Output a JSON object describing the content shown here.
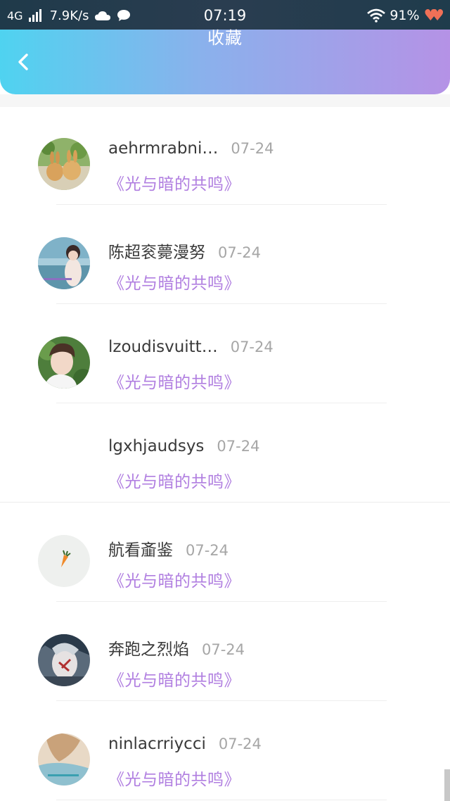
{
  "status_bar": {
    "network": "4G",
    "speed": "7.9K/s",
    "time": "07:19",
    "battery": "91%"
  },
  "header": {
    "title": "收藏"
  },
  "items": [
    {
      "name": "aehrmrabni…",
      "date": "07-24",
      "book": "《光与暗的共鸣》",
      "avatar": "avatar-rabbits"
    },
    {
      "name": "陈超衮薨漫努",
      "date": "07-24",
      "book": "《光与暗的共鸣》",
      "avatar": "avatar-seaside-girl"
    },
    {
      "name": "lzoudisvuitt…",
      "date": "07-24",
      "book": "《光与暗的共鸣》",
      "avatar": "avatar-young-man"
    },
    {
      "name": "lgxhjaudsys",
      "date": "07-24",
      "book": "《光与暗的共鸣》",
      "avatar": "none"
    },
    {
      "name": "航看齑鉴",
      "date": "07-24",
      "book": "《光与暗的共鸣》",
      "avatar": "avatar-carrot"
    },
    {
      "name": "奔跑之烈焰",
      "date": "07-24",
      "book": "《光与暗的共鸣》",
      "avatar": "avatar-anime"
    },
    {
      "name": "ninlacrriycci",
      "date": "07-24",
      "book": "《光与暗的共鸣》",
      "avatar": "avatar-woman"
    }
  ]
}
